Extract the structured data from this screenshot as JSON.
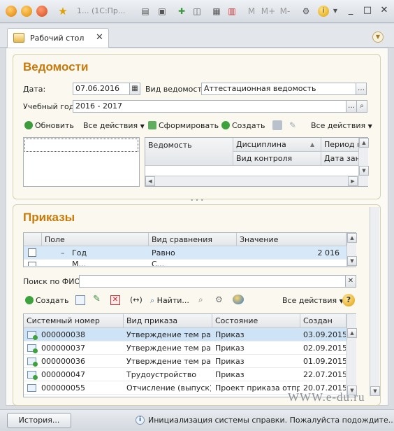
{
  "titlebar": {
    "window_title": "1... (1С:Пр...",
    "tool_m1": "M",
    "tool_m2": "M+",
    "tool_m3": "M-"
  },
  "tab": {
    "label": "Рабочий стол",
    "close": "✕"
  },
  "vedomosti": {
    "title": "Ведомости",
    "date_label": "Дата:",
    "date_value": "07.06.2016",
    "vid_label": "Вид ведомости:",
    "vid_value": "Аттестационная ведомость",
    "year_label": "Учебный год:",
    "year_value": "2016 - 2017",
    "cmd_refresh": "Обновить",
    "cmd_all_actions_left": "Все действия",
    "cmd_form": "Сформировать",
    "cmd_create": "Создать",
    "cmd_all_actions_right": "Все действия",
    "grid_headers": [
      "Ведомость",
      "Дисциплина",
      "Период к",
      "Вид контроля",
      "Дата зан"
    ]
  },
  "prikazy": {
    "title": "Приказы",
    "filter_headers": [
      "Поле",
      "Вид сравнения",
      "Значение"
    ],
    "filter_row": {
      "field": "Год",
      "comparison": "Равно",
      "value": "2 016"
    },
    "filter_row2": {
      "field": "М...",
      "comparison": "С..."
    },
    "search_label": "Поиск по ФИО:",
    "search_value": "",
    "cmd_create": "Создать",
    "cmd_find": "Найти...",
    "cmd_all_actions": "Все действия",
    "help_icon": "?",
    "grid_headers": [
      "Системный номер",
      "Вид приказа",
      "Состояние",
      "Создан"
    ],
    "rows": [
      {
        "number": "000000038",
        "type": "Утверждение тем ра...",
        "state": "Приказ",
        "created": "03.09.2015 0",
        "icon": "doc-check"
      },
      {
        "number": "000000037",
        "type": "Утверждение тем ра...",
        "state": "Приказ",
        "created": "02.09.2015 1",
        "icon": "doc-check"
      },
      {
        "number": "000000036",
        "type": "Утверждение тем ра...",
        "state": "Приказ",
        "created": "01.09.2015 1",
        "icon": "doc-check"
      },
      {
        "number": "000000047",
        "type": "Трудоустройство",
        "state": "Приказ",
        "created": "22.07.2015 1",
        "icon": "doc-check"
      },
      {
        "number": "000000055",
        "type": "Отчисление (выпуск)...",
        "state": "Проект приказа отпр...",
        "created": "20.07.2015 1",
        "icon": "doc"
      }
    ]
  },
  "statusbar": {
    "history_button": "История...",
    "message": "Инициализация системы справки. Пожалуйста подождите...",
    "info_icon": "i"
  },
  "watermark": "WWW.e-du.ru",
  "colors": {
    "panel_title": "#c9790a",
    "selected_row": "#cfe3f6",
    "filter_row": "#d7e9f8"
  }
}
